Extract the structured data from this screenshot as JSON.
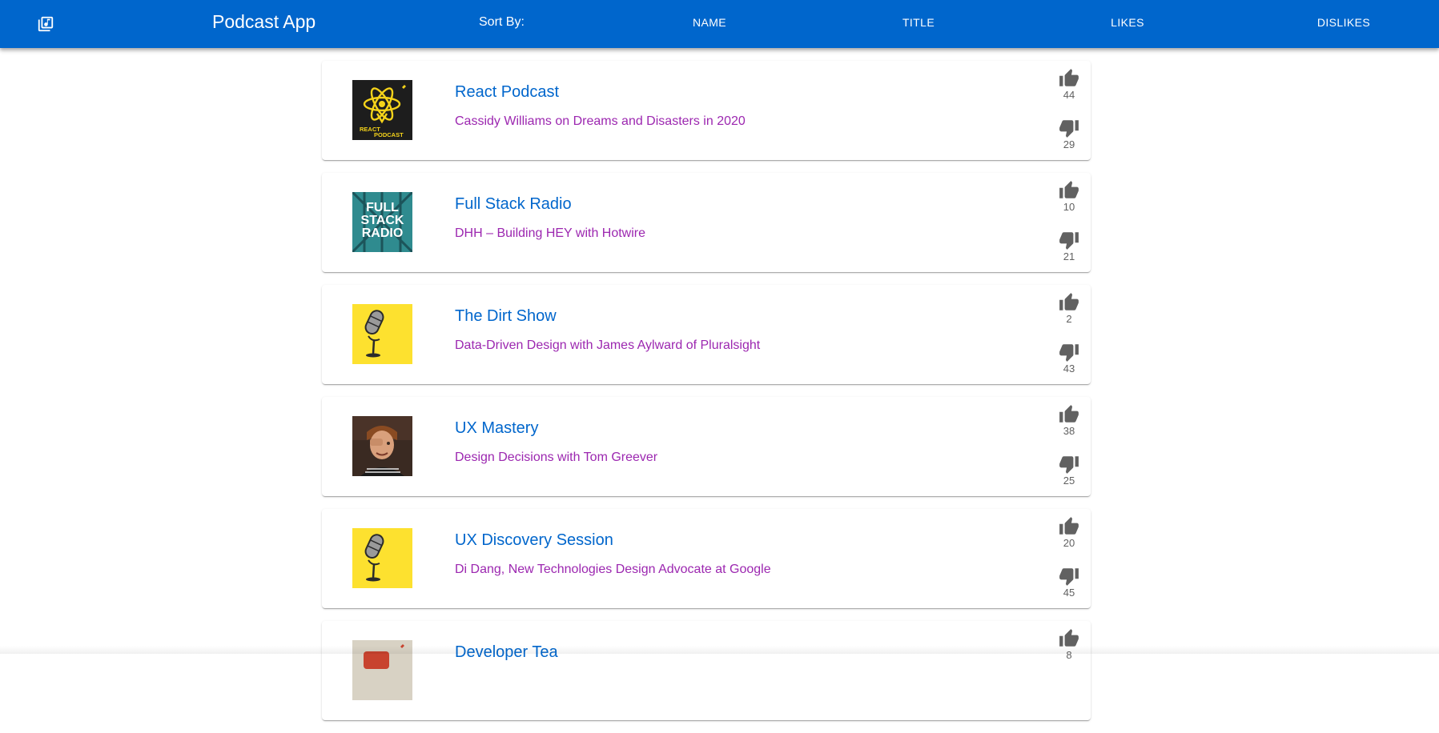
{
  "appbar": {
    "logo_icon": "library-music-icon",
    "title": "Podcast App",
    "sort_label": "Sort By:",
    "sort_options": [
      "NAME",
      "TITLE",
      "LIKES",
      "DISLIKES"
    ],
    "color": "#0066cc"
  },
  "podcasts": [
    {
      "name": "React Podcast",
      "episode": "Cassidy Williams on Dreams and Disasters in 2020",
      "likes": "44",
      "dislikes": "29",
      "art": "react-podcast-art"
    },
    {
      "name": "Full Stack Radio",
      "episode": "DHH – Building HEY with Hotwire",
      "likes": "10",
      "dislikes": "21",
      "art": "full-stack-radio-art"
    },
    {
      "name": "The Dirt Show",
      "episode": "Data-Driven Design with James Aylward of Pluralsight",
      "likes": "2",
      "dislikes": "43",
      "art": "microphone-art"
    },
    {
      "name": "UX Mastery",
      "episode": "Design Decisions with Tom Greever",
      "likes": "38",
      "dislikes": "25",
      "art": "portrait-art"
    },
    {
      "name": "UX Discovery Session",
      "episode": "Di Dang, New Technologies Design Advocate at Google",
      "likes": "20",
      "dislikes": "45",
      "art": "microphone-art"
    },
    {
      "name": "Developer Tea",
      "episode": "",
      "likes": "8",
      "dislikes": "",
      "art": "developer-tea-art"
    }
  ],
  "art_text": {
    "react_podcast": [
      "REACT",
      "PODCAST"
    ],
    "full_stack_radio": [
      "FULL",
      "STACK",
      "RADIO"
    ]
  },
  "colors": {
    "title": "#0066cc",
    "subtitle": "#9c27b0",
    "icon": "#616161"
  }
}
